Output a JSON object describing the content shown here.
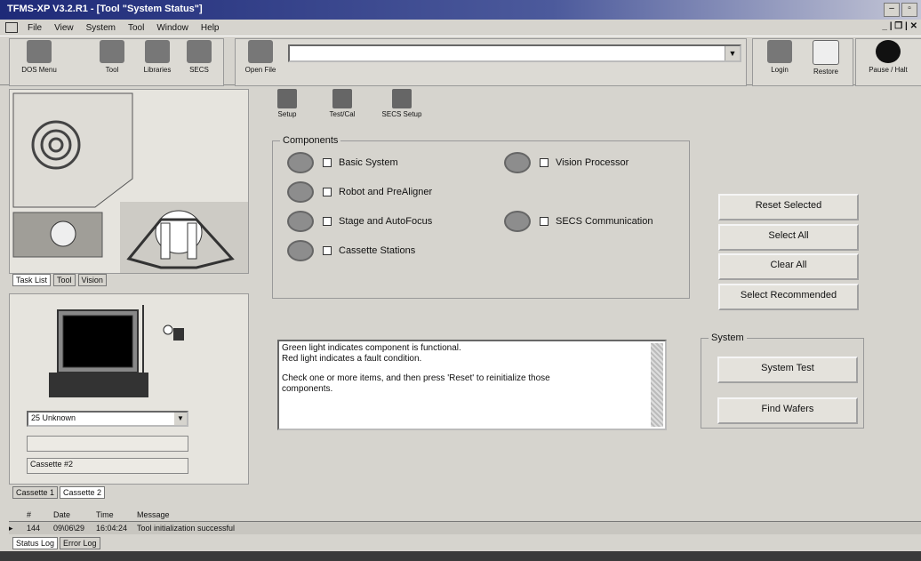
{
  "window": {
    "title": "TFMS-XP V3.2.R1 - [Tool \"System Status\"]"
  },
  "menu": [
    "File",
    "View",
    "System",
    "Tool",
    "Window",
    "Help"
  ],
  "toolbar": {
    "dos_menu": "DOS Menu",
    "tool": "Tool",
    "libraries": "Libraries",
    "secs": "SECS",
    "open_file": "Open File",
    "login": "Login",
    "restore": "Restore",
    "pause_halt": "Pause / Halt"
  },
  "left": {
    "tabs": [
      "Task List",
      "Tool",
      "Vision"
    ],
    "cassette_select": "25 Unknown",
    "cassette_label": "Cassette #2",
    "bottom_tabs": [
      "Cassette 1",
      "Cassette 2"
    ]
  },
  "subtoolbar": {
    "setup": "Setup",
    "testcal": "Test/Cal",
    "secs_setup": "SECS Setup"
  },
  "components": {
    "title": "Components",
    "items": [
      "Basic System",
      "Vision Processor",
      "Robot and PreAligner",
      "Stage and AutoFocus",
      "SECS Communication",
      "Cassette Stations"
    ]
  },
  "buttons": {
    "reset_selected": "Reset Selected",
    "select_all": "Select All",
    "clear_all": "Clear All",
    "select_recommended": "Select Recommended"
  },
  "message": {
    "line1": "Green light indicates component is functional.",
    "line2": "Red light indicates a fault condition.",
    "line3": "Check one or more items, and then press 'Reset' to reinitialize those",
    "line4": "components."
  },
  "system": {
    "title": "System",
    "system_test": "System Test",
    "find_wafers": "Find Wafers"
  },
  "log": {
    "headers": [
      "#",
      "Date",
      "Time",
      "Message"
    ],
    "row": {
      "num": "144",
      "date": "09\\06\\29",
      "time": "16:04:24",
      "msg": "Tool initialization successful"
    },
    "tabs": [
      "Status Log",
      "Error Log"
    ]
  }
}
